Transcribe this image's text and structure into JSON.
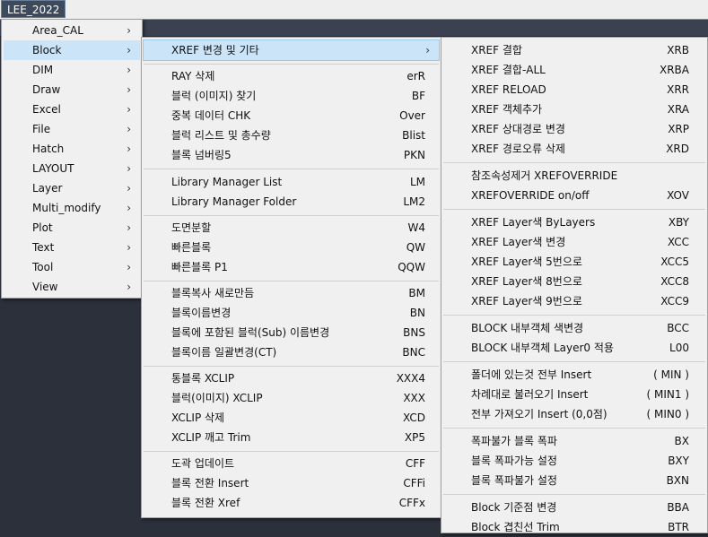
{
  "menubar": {
    "title": "LEE_2022"
  },
  "menu1": {
    "items": [
      {
        "label": "Area_CAL"
      },
      {
        "label": "Block"
      },
      {
        "label": "DIM"
      },
      {
        "label": "Draw"
      },
      {
        "label": "Excel"
      },
      {
        "label": "File"
      },
      {
        "label": "Hatch"
      },
      {
        "label": "LAYOUT"
      },
      {
        "label": "Layer"
      },
      {
        "label": "Multi_modify"
      },
      {
        "label": "Plot"
      },
      {
        "label": "Text"
      },
      {
        "label": "Tool"
      },
      {
        "label": "View"
      }
    ],
    "arrow": "›"
  },
  "menu2": {
    "header": {
      "label": "XREF 변경 및 기타",
      "arrow": "›"
    },
    "groups": [
      [
        {
          "label": "RAY 삭제",
          "shortcut": "erR"
        },
        {
          "label": "블럭 (이미지) 찾기",
          "shortcut": "BF"
        },
        {
          "label": "중복 데이터 CHK",
          "shortcut": "Over"
        },
        {
          "label": "블럭 리스트 및 총수량",
          "shortcut": "Blist"
        },
        {
          "label": "블록 넘버링5",
          "shortcut": "PKN"
        }
      ],
      [
        {
          "label": "Library Manager List",
          "shortcut": "LM"
        },
        {
          "label": "Library Manager Folder",
          "shortcut": "LM2"
        }
      ],
      [
        {
          "label": "도면분할",
          "shortcut": "W4"
        },
        {
          "label": "빠른블록",
          "shortcut": "QW"
        },
        {
          "label": "빠른블록 P1",
          "shortcut": "QQW"
        }
      ],
      [
        {
          "label": "블록복사 새로만듬",
          "shortcut": "BM"
        },
        {
          "label": "블록이름변경",
          "shortcut": "BN"
        },
        {
          "label": "블록에 포함된 블럭(Sub) 이름변경",
          "shortcut": "BNS"
        },
        {
          "label": "블록이름 일괄변경(CT)",
          "shortcut": "BNC"
        }
      ],
      [
        {
          "label": "통블록 XCLIP",
          "shortcut": "XXX4"
        },
        {
          "label": "블럭(이미지) XCLIP",
          "shortcut": "XXX"
        },
        {
          "label": "XCLIP 삭제",
          "shortcut": "XCD"
        },
        {
          "label": "XCLIP 깨고 Trim",
          "shortcut": "XP5"
        }
      ],
      [
        {
          "label": "도곽 업데이트",
          "shortcut": "CFF"
        },
        {
          "label": "블록 전환 Insert",
          "shortcut": "CFFi"
        },
        {
          "label": "블록 전환 Xref",
          "shortcut": "CFFx"
        }
      ]
    ]
  },
  "menu3": {
    "groups": [
      [
        {
          "label": "XREF 결합",
          "shortcut": "XRB"
        },
        {
          "label": "XREF 결합-ALL",
          "shortcut": "XRBA"
        },
        {
          "label": "XREF RELOAD",
          "shortcut": "XRR"
        },
        {
          "label": "XREF 객체추가",
          "shortcut": "XRA"
        },
        {
          "label": "XREF 상대경로 변경",
          "shortcut": "XRP"
        },
        {
          "label": "XREF 경로오류 삭제",
          "shortcut": "XRD"
        }
      ],
      [
        {
          "label": "참조속성제거  XREFOVERRIDE",
          "shortcut": ""
        },
        {
          "label": "XREFOVERRIDE on/off",
          "shortcut": "XOV"
        }
      ],
      [
        {
          "label": "XREF Layer색 ByLayers",
          "shortcut": "XBY"
        },
        {
          "label": "XREF Layer색 변경",
          "shortcut": "XCC"
        },
        {
          "label": "XREF Layer색 5번으로",
          "shortcut": "XCC5"
        },
        {
          "label": "XREF Layer색 8번으로",
          "shortcut": "XCC8"
        },
        {
          "label": "XREF Layer색 9번으로",
          "shortcut": "XCC9"
        }
      ],
      [
        {
          "label": "BLOCK 내부객체 색변경",
          "shortcut": "BCC"
        },
        {
          "label": "BLOCK 내부객체 Layer0 적용",
          "shortcut": "L00"
        }
      ],
      [
        {
          "label": "폴더에 있는것 전부 Insert",
          "shortcut": "( MIN )"
        },
        {
          "label": "차례대로 불러오기 Insert",
          "shortcut": "( MIN1 )"
        },
        {
          "label": "전부 가져오기 Insert (0,0점)",
          "shortcut": "( MIN0 )"
        }
      ],
      [
        {
          "label": "폭파불가 블록 폭파",
          "shortcut": "BX"
        },
        {
          "label": "블록 폭파가능 설정",
          "shortcut": "BXY"
        },
        {
          "label": "블록 폭파불가 설정",
          "shortcut": "BXN"
        }
      ],
      [
        {
          "label": "Block 기준점 변경",
          "shortcut": "BBA"
        },
        {
          "label": "Block 겹친선 Trim",
          "shortcut": "BTR"
        }
      ]
    ]
  }
}
